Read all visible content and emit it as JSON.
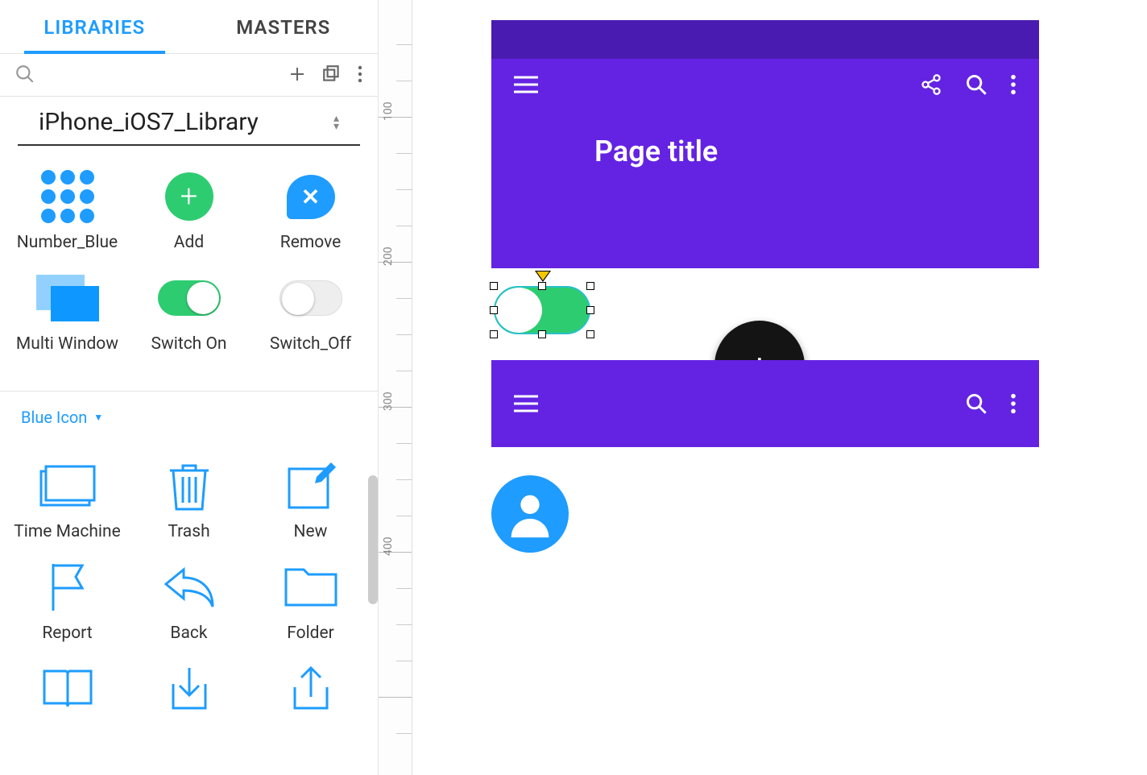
{
  "tabs": {
    "libraries": "LIBRARIES",
    "masters": "MASTERS"
  },
  "library": {
    "title": "iPhone_iOS7_Library",
    "section": "Blue Icon",
    "components_a": [
      {
        "label": "Number_Blue",
        "icon": "number-blue"
      },
      {
        "label": "Add",
        "icon": "green-add"
      },
      {
        "label": "Remove",
        "icon": "remove"
      },
      {
        "label": "Multi Window",
        "icon": "multi-window"
      },
      {
        "label": "Switch On",
        "icon": "switch-on"
      },
      {
        "label": "Switch_Off",
        "icon": "switch-off"
      }
    ],
    "components_b": [
      {
        "label": "Time Machine"
      },
      {
        "label": "Trash"
      },
      {
        "label": "New"
      },
      {
        "label": "Report"
      },
      {
        "label": "Back"
      },
      {
        "label": "Folder"
      }
    ]
  },
  "ruler_marks": [
    "100",
    "200",
    "300",
    "400"
  ],
  "canvas": {
    "page_title": "Page title"
  }
}
